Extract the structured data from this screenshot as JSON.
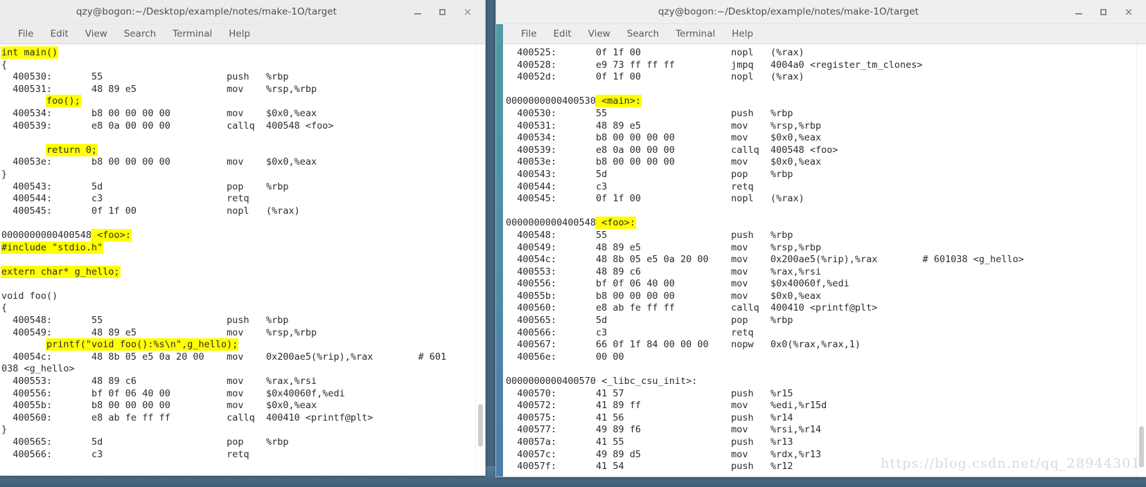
{
  "desktop": {
    "background_color": "#45647e"
  },
  "watermark": {
    "text": "https://blog.csdn.net/qq_28944301"
  },
  "windows": {
    "left": {
      "title": "qzy@bogon:~/Desktop/example/notes/make-1O/target",
      "focused": false,
      "accent_color": "#ececec",
      "menu": [
        "File",
        "Edit",
        "View",
        "Search",
        "Terminal",
        "Help"
      ],
      "buttons": {
        "minimize": "minimize",
        "maximize": "maximize",
        "close": "×"
      },
      "lines": [
        {
          "text": "int main()",
          "hl": [
            [
              0,
              10
            ]
          ]
        },
        {
          "text": "{"
        },
        {
          "text": "  400530:\t55                      push   %rbp"
        },
        {
          "text": "  400531:\t48 89 e5                mov    %rsp,%rbp"
        },
        {
          "text": "        foo();",
          "hl": [
            [
              8,
              14
            ]
          ]
        },
        {
          "text": "  400534:\tb8 00 00 00 00          mov    $0x0,%eax"
        },
        {
          "text": "  400539:\te8 0a 00 00 00          callq  400548 <foo>"
        },
        {
          "text": ""
        },
        {
          "text": "        return 0;",
          "hl": [
            [
              8,
              17
            ]
          ]
        },
        {
          "text": "  40053e:\tb8 00 00 00 00          mov    $0x0,%eax"
        },
        {
          "text": "}"
        },
        {
          "text": "  400543:\t5d                      pop    %rbp"
        },
        {
          "text": "  400544:\tc3                      retq"
        },
        {
          "text": "  400545:\t0f 1f 00                nopl   (%rax)"
        },
        {
          "text": ""
        },
        {
          "text": "0000000000400548 <foo>:",
          "hl": [
            [
              16,
              23
            ]
          ]
        },
        {
          "text": "#include \"stdio.h\"",
          "hl": [
            [
              0,
              18
            ]
          ]
        },
        {
          "text": ""
        },
        {
          "text": "extern char* g_hello;",
          "hl": [
            [
              0,
              21
            ]
          ]
        },
        {
          "text": ""
        },
        {
          "text": "void foo()"
        },
        {
          "text": "{"
        },
        {
          "text": "  400548:\t55                      push   %rbp"
        },
        {
          "text": "  400549:\t48 89 e5                mov    %rsp,%rbp"
        },
        {
          "text": "        printf(\"void foo():%s\\n\",g_hello);",
          "hl": [
            [
              8,
              42
            ]
          ]
        },
        {
          "text": "  40054c:\t48 8b 05 e5 0a 20 00    mov    0x200ae5(%rip),%rax        # 601"
        },
        {
          "text": "038 <g_hello>"
        },
        {
          "text": "  400553:\t48 89 c6                mov    %rax,%rsi"
        },
        {
          "text": "  400556:\tbf 0f 06 40 00          mov    $0x40060f,%edi"
        },
        {
          "text": "  40055b:\tb8 00 00 00 00          mov    $0x0,%eax"
        },
        {
          "text": "  400560:\te8 ab fe ff ff          callq  400410 <printf@plt>"
        },
        {
          "text": "}"
        },
        {
          "text": "  400565:\t5d                      pop    %rbp"
        },
        {
          "text": "  400566:\tc3                      retq"
        }
      ]
    },
    "right": {
      "title": "qzy@bogon:~/Desktop/example/notes/make-1O/target",
      "focused": true,
      "accent_color": "#4f92a6",
      "menu": [
        "File",
        "Edit",
        "View",
        "Search",
        "Terminal",
        "Help"
      ],
      "buttons": {
        "minimize": "minimize",
        "maximize": "maximize",
        "close": "×"
      },
      "lines": [
        {
          "text": "  400525:\t0f 1f 00                nopl   (%rax)"
        },
        {
          "text": "  400528:\te9 73 ff ff ff          jmpq   4004a0 <register_tm_clones>"
        },
        {
          "text": "  40052d:\t0f 1f 00                nopl   (%rax)"
        },
        {
          "text": ""
        },
        {
          "text": "0000000000400530 <main>:",
          "hl": [
            [
              16,
              24
            ]
          ]
        },
        {
          "text": "  400530:\t55                      push   %rbp"
        },
        {
          "text": "  400531:\t48 89 e5                mov    %rsp,%rbp"
        },
        {
          "text": "  400534:\tb8 00 00 00 00          mov    $0x0,%eax"
        },
        {
          "text": "  400539:\te8 0a 00 00 00          callq  400548 <foo>"
        },
        {
          "text": "  40053e:\tb8 00 00 00 00          mov    $0x0,%eax"
        },
        {
          "text": "  400543:\t5d                      pop    %rbp"
        },
        {
          "text": "  400544:\tc3                      retq"
        },
        {
          "text": "  400545:\t0f 1f 00                nopl   (%rax)"
        },
        {
          "text": ""
        },
        {
          "text": "0000000000400548 <foo>:",
          "hl": [
            [
              16,
              23
            ]
          ]
        },
        {
          "text": "  400548:\t55                      push   %rbp"
        },
        {
          "text": "  400549:\t48 89 e5                mov    %rsp,%rbp"
        },
        {
          "text": "  40054c:\t48 8b 05 e5 0a 20 00    mov    0x200ae5(%rip),%rax        # 601038 <g_hello>"
        },
        {
          "text": "  400553:\t48 89 c6                mov    %rax,%rsi"
        },
        {
          "text": "  400556:\tbf 0f 06 40 00          mov    $0x40060f,%edi"
        },
        {
          "text": "  40055b:\tb8 00 00 00 00          mov    $0x0,%eax"
        },
        {
          "text": "  400560:\te8 ab fe ff ff          callq  400410 <printf@plt>"
        },
        {
          "text": "  400565:\t5d                      pop    %rbp"
        },
        {
          "text": "  400566:\tc3                      retq"
        },
        {
          "text": "  400567:\t66 0f 1f 84 00 00 00    nopw   0x0(%rax,%rax,1)"
        },
        {
          "text": "  40056e:\t00 00"
        },
        {
          "text": ""
        },
        {
          "text": "0000000000400570 <_libc_csu_init>:"
        },
        {
          "text": "  400570:\t41 57                   push   %r15"
        },
        {
          "text": "  400572:\t41 89 ff                mov    %edi,%r15d"
        },
        {
          "text": "  400575:\t41 56                   push   %r14"
        },
        {
          "text": "  400577:\t49 89 f6                mov    %rsi,%r14"
        },
        {
          "text": "  40057a:\t41 55                   push   %r13"
        },
        {
          "text": "  40057c:\t49 89 d5                mov    %rdx,%r13"
        },
        {
          "text": "  40057f:\t41 54                   push   %r12"
        }
      ]
    }
  }
}
